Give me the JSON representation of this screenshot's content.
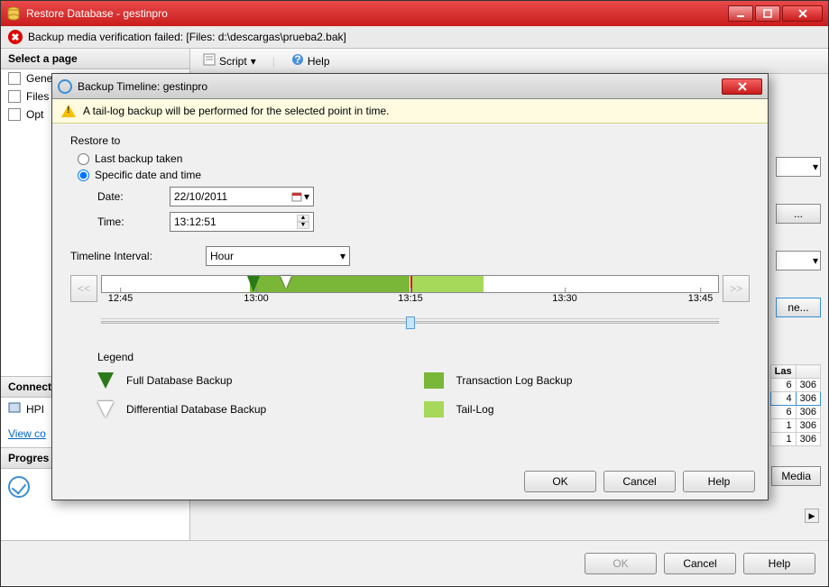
{
  "main_window": {
    "title": "Restore Database - gestinpro",
    "error_message": "Backup media verification failed:  [Files: d:\\descargas\\prueba2.bak]"
  },
  "sidebar": {
    "select_page": "Select a page",
    "items": [
      {
        "label": "General"
      },
      {
        "label": "Files"
      },
      {
        "label": "Opt"
      }
    ],
    "connection_header": "Connect",
    "connection_item": "HPI",
    "view_link": "View co",
    "progress_header": "Progres"
  },
  "toolbar": {
    "script": "Script",
    "help": "Help"
  },
  "main_footer": {
    "ok": "OK",
    "cancel": "Cancel",
    "help": "Help"
  },
  "right_stubs": {
    "timeline_btn": "ne...",
    "dots_btn": "...",
    "verify_btn": "Media",
    "table": {
      "head": "Las",
      "rows": [
        {
          "a": "6",
          "b": "306"
        },
        {
          "a": "4",
          "b": "306",
          "selected": true
        },
        {
          "a": "6",
          "b": "306"
        },
        {
          "a": "1",
          "b": "306"
        },
        {
          "a": "1",
          "b": "306"
        }
      ]
    }
  },
  "modal": {
    "title": "Backup Timeline: gestinpro",
    "warning": "A tail-log backup will be performed for the selected point in time.",
    "restore_to": "Restore to",
    "radio_last": "Last backup taken",
    "radio_specific": "Specific date and time",
    "date_label": "Date:",
    "date_value": "22/10/2011",
    "time_label": "Time:",
    "time_value": "13:12:51",
    "interval_label": "Timeline Interval:",
    "interval_value": "Hour",
    "nav_prev": "<<",
    "nav_next": ">>",
    "ticks": [
      "12:45",
      "13:00",
      "13:15",
      "13:30",
      "13:45"
    ],
    "legend": {
      "title": "Legend",
      "full": "Full Database Backup",
      "diff": "Differential Database Backup",
      "tlog": "Transaction Log Backup",
      "tail": "Tail-Log"
    },
    "buttons": {
      "ok": "OK",
      "cancel": "Cancel",
      "help": "Help"
    }
  }
}
